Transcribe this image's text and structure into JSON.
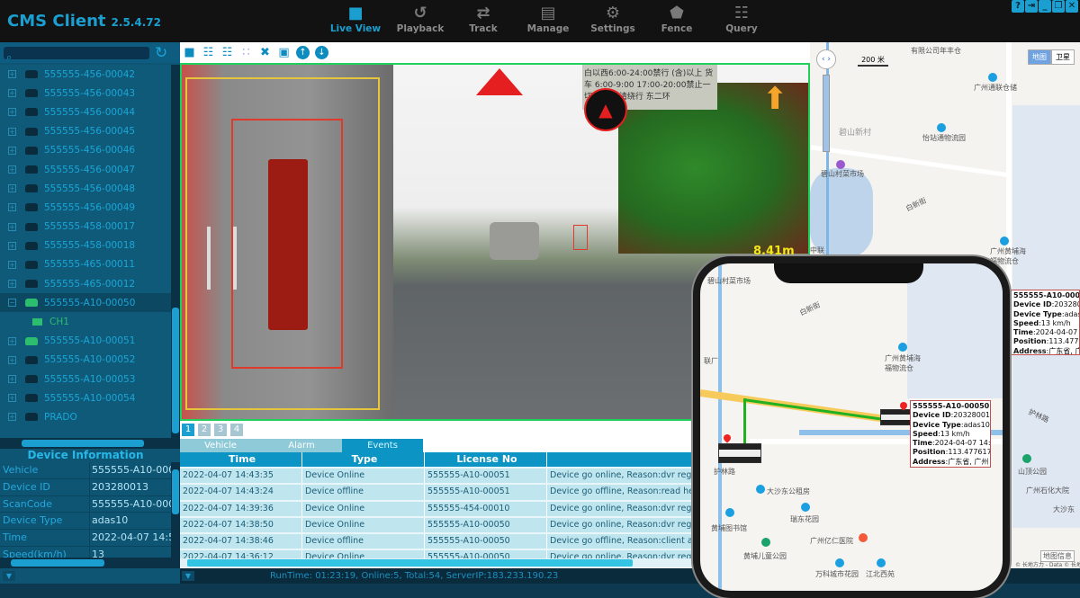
{
  "app": {
    "title": "CMS Client",
    "version": "2.5.4.72"
  },
  "nav": [
    {
      "label": "Live View",
      "icon": "video-camera-icon",
      "active": true
    },
    {
      "label": "Playback",
      "icon": "playback-icon"
    },
    {
      "label": "Track",
      "icon": "track-icon"
    },
    {
      "label": "Manage",
      "icon": "chart-icon"
    },
    {
      "label": "Settings",
      "icon": "gear-icon"
    },
    {
      "label": "Fence",
      "icon": "pentagon-icon"
    },
    {
      "label": "Query",
      "icon": "document-search-icon"
    }
  ],
  "window_buttons": [
    "?",
    "⇥",
    "_",
    "❐",
    "✕"
  ],
  "search": {
    "placeholder": ""
  },
  "tree": [
    {
      "label": "555555-456-00042",
      "online": false
    },
    {
      "label": "555555-456-00043",
      "online": false
    },
    {
      "label": "555555-456-00044",
      "online": false
    },
    {
      "label": "555555-456-00045",
      "online": false
    },
    {
      "label": "555555-456-00046",
      "online": false
    },
    {
      "label": "555555-456-00047",
      "online": false
    },
    {
      "label": "555555-456-00048",
      "online": false
    },
    {
      "label": "555555-456-00049",
      "online": false
    },
    {
      "label": "555555-458-00017",
      "online": false
    },
    {
      "label": "555555-458-00018",
      "online": false
    },
    {
      "label": "555555-465-00011",
      "online": false
    },
    {
      "label": "555555-465-00012",
      "online": false
    },
    {
      "label": "555555-A10-00050",
      "online": true,
      "expanded": true,
      "selected": true
    },
    {
      "label": "CH1",
      "channel": true
    },
    {
      "label": "555555-A10-00051",
      "online": true
    },
    {
      "label": "555555-A10-00052",
      "online": false
    },
    {
      "label": "555555-A10-00053",
      "online": false
    },
    {
      "label": "555555-A10-00054",
      "online": false
    },
    {
      "label": "PRADO",
      "online": false
    }
  ],
  "device_info": {
    "title": "Device Information",
    "rows": [
      {
        "k": "Vehicle",
        "v": "555555-A10-000"
      },
      {
        "k": "Device ID",
        "v": "203280013"
      },
      {
        "k": "ScanCode",
        "v": "555555-A10-000"
      },
      {
        "k": "Device Type",
        "v": "adas10"
      },
      {
        "k": "Time",
        "v": "2022-04-07 14:5"
      },
      {
        "k": "Speed(km/h)",
        "v": "13"
      }
    ]
  },
  "video": {
    "distance": "8.41m",
    "sign_text": "白以西6:00-24:00禁行 (含)以上 货车 6:00-9:00 17:00-20:00禁止一切货车 辆请绕行 东二环"
  },
  "pages": [
    "1",
    "2",
    "3",
    "4"
  ],
  "bottom_tabs": [
    {
      "label": "Vehicle"
    },
    {
      "label": "Alarm"
    },
    {
      "label": "Events",
      "active": true
    }
  ],
  "events": {
    "headers": [
      "Time",
      "Type",
      "License No",
      ""
    ],
    "rows": [
      [
        "2022-04-07 14:43:35",
        "Device Online",
        "555555-A10-00051",
        "Device go online, Reason:dvr register c"
      ],
      [
        "2022-04-07 14:43:24",
        "Device offline",
        "555555-A10-00051",
        "Device go offline, Reason:read header"
      ],
      [
        "2022-04-07 14:39:36",
        "Device Online",
        "555555-454-00010",
        "Device go online, Reason:dvr register c"
      ],
      [
        "2022-04-07 14:38:50",
        "Device Online",
        "555555-A10-00050",
        "Device go online, Reason:dvr register c"
      ],
      [
        "2022-04-07 14:38:46",
        "Device offline",
        "555555-A10-00050",
        "Device go offline, Reason:client alive ti"
      ],
      [
        "2022-04-07 14:36:12",
        "Device Online",
        "555555-A10-00050",
        "Device go online, Reason:dvr regist"
      ]
    ]
  },
  "status": "RunTime: 01:23:19, Online:5, Total:54, ServerIP:183.233.190.23",
  "map": {
    "scale": "200 米",
    "type_buttons": [
      {
        "label": "地图",
        "active": true
      },
      {
        "label": "卫星"
      }
    ],
    "labels": [
      "有限公司年丰仓",
      "广州通联仓储",
      "碧山新村",
      "怡站通物流园",
      "碧山村菜市场",
      "白新街",
      "广州黄埔海福物流仓",
      "中联",
      "山顶公园",
      "广州石化大院",
      "大沙东",
      "护林路",
      "地图信息"
    ],
    "copyright": "© 长地方力 - Data © 长地方力"
  },
  "popup": {
    "title": "555555-A10-00050",
    "lines": [
      {
        "k": "Device ID",
        "v": "203280013"
      },
      {
        "k": "Device Type",
        "v": "adas10"
      },
      {
        "k": "Speed",
        "v": "13 km/h"
      },
      {
        "k": "Time",
        "v": "2024-04-07 14:5"
      },
      {
        "k": "Position",
        "v": "113.477617,"
      },
      {
        "k": "Address",
        "v": "广东省, 广州"
      },
      {
        "k": "Status",
        "v": "4G,GPS Norm"
      }
    ]
  },
  "phone_map": {
    "labels": [
      "碧山村菜市场",
      "白新街",
      "广州黄埔海福物流仓",
      "联厂",
      "护林路",
      "大沙东公租房",
      "瑞东花园",
      "黄埔图书馆",
      "广州亿仁医院",
      "黄埔儿童公园",
      "万科城市花园",
      "江北西苑"
    ]
  },
  "colors": {
    "accent": "#1a9fd0",
    "online": "#2dbd6e",
    "alarm": "#e51f1f",
    "route": "#20b020"
  }
}
